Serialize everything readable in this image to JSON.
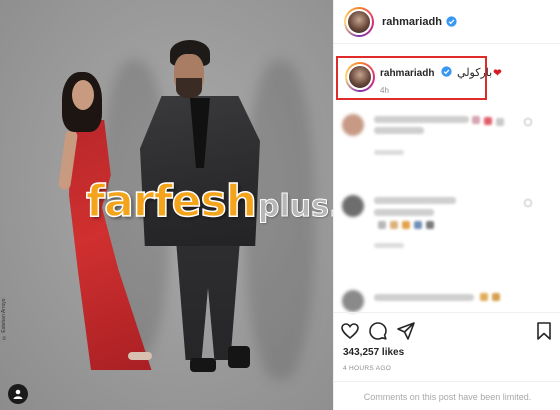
{
  "photo": {
    "watermark_main": "farfesh",
    "watermark_sub": "plus.com",
    "credit_text": "© Esteban Arroyo"
  },
  "post": {
    "username": "rahmariadh",
    "verified": true,
    "caption_username": "rahmariadh",
    "caption_text": "باركولي",
    "caption_emoji": "❤",
    "caption_time": "4h",
    "likes": "343,257 likes",
    "posted_ago": "4 HOURS AGO",
    "comments_limited_notice": "Comments on this post have been limited."
  },
  "colors": {
    "highlight_border": "#e02b2b",
    "verified_blue": "#3897f0",
    "watermark_orange": "#f3a41b"
  },
  "icons": [
    "heart-icon",
    "comment-icon",
    "share-icon",
    "bookmark-icon",
    "verified-icon",
    "user-tag-icon"
  ]
}
